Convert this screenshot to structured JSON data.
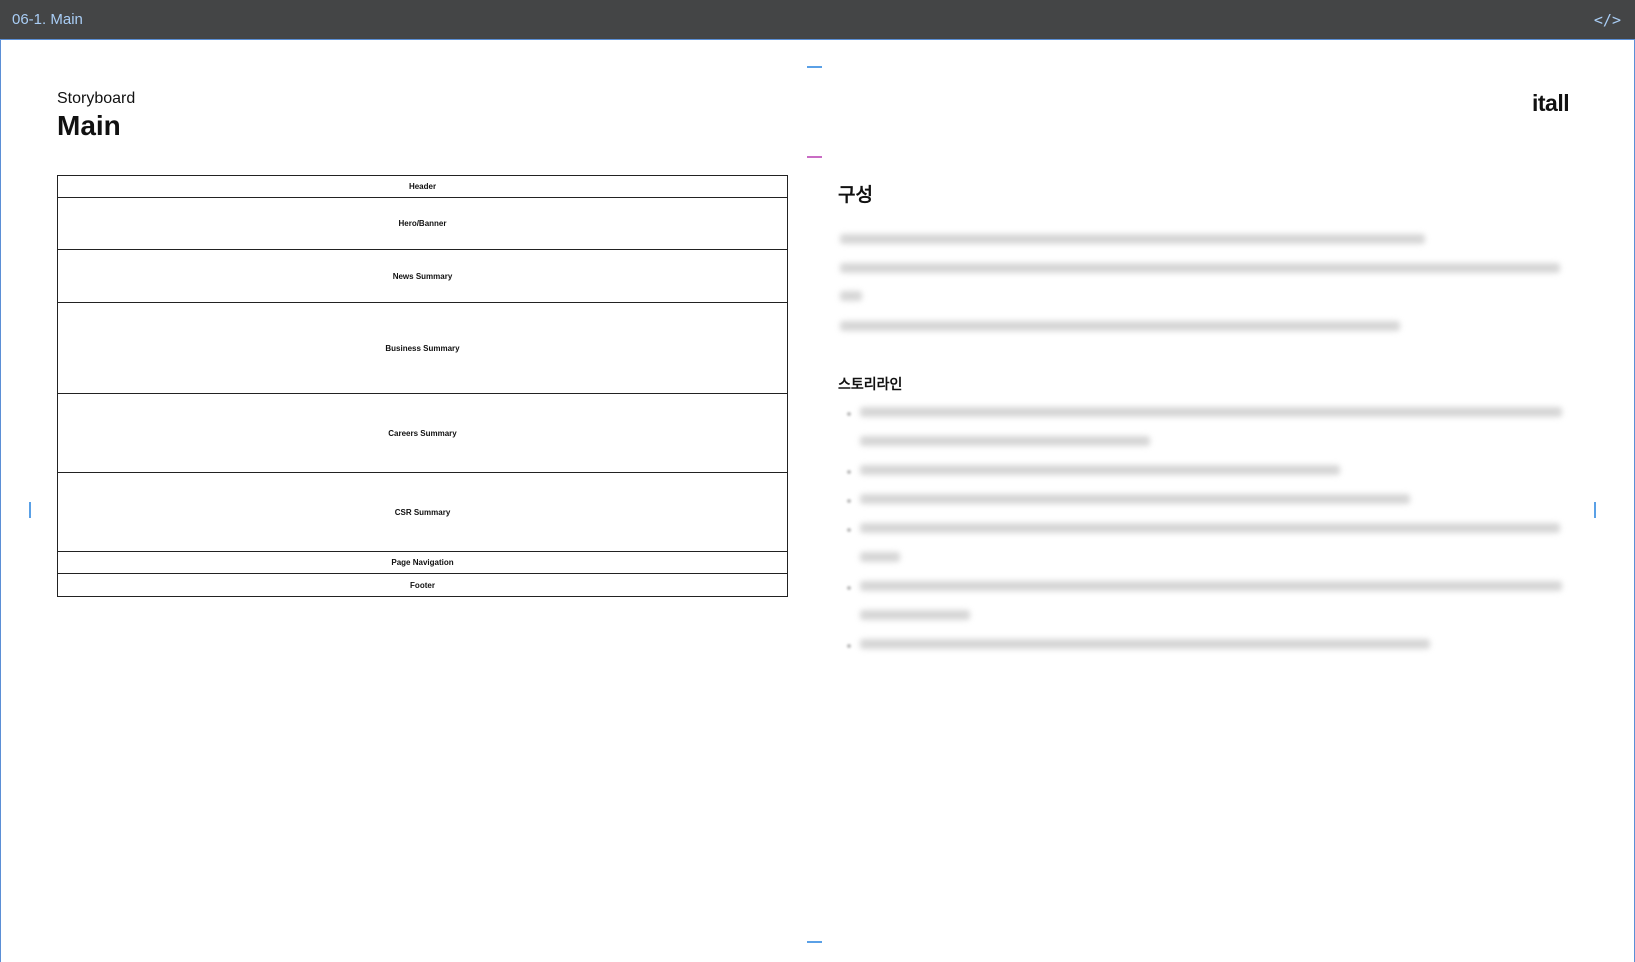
{
  "topbar": {
    "title": "06-1. Main",
    "code_icon": "</>"
  },
  "storyboard": {
    "label": "Storyboard",
    "title": "Main",
    "brand": "itall"
  },
  "wireframe": {
    "sections": [
      "Header",
      "Hero/Banner",
      "News Summary",
      "Business Summary",
      "Careers Summary",
      "CSR Summary",
      "Page Navigation",
      "Footer"
    ]
  },
  "description": {
    "heading": "구성",
    "storyline_heading": "스토리라인"
  },
  "colors": {
    "topbar_bg": "#444546",
    "topbar_text": "#a9cdf5",
    "frame_border": "#5b8fd6",
    "guide_blue": "#5aa0e6",
    "guide_pink": "#c96cc4"
  }
}
